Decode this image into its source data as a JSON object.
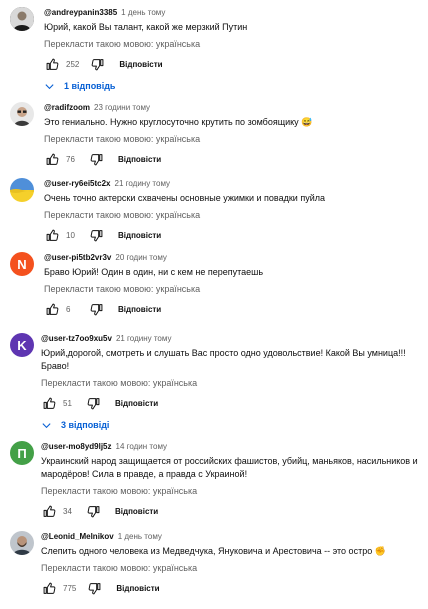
{
  "translate_label": "Перекласти такою мовою: українська",
  "reply_label": "Відповісти",
  "comments": [
    {
      "author": "@andreypanin3385",
      "time": "1 день тому",
      "text": "Юрий, какой Вы талант, какой же мерзкий Путин",
      "likes": "252",
      "replies": "1 відповідь",
      "avatar_icon": "man-in-dark-shirt-photo"
    },
    {
      "author": "@radifzoom",
      "time": "23 години тому",
      "text": "Это гениально. Нужно круглосуточно крутить по зомбоящику 😅",
      "likes": "76",
      "replies": "",
      "avatar_icon": "man-in-glasses-photo"
    },
    {
      "author": "@user-ry6ei5tc2x",
      "time": "21 годину тому",
      "text": "Очень точно актерски схвачены основные ужимки и повадки пуйла",
      "likes": "10",
      "replies": "",
      "avatar_icon": "ukrainian-flag-photo"
    },
    {
      "author": "@user-pi5tb2vr3v",
      "time": "20 годин тому",
      "text": "Браво Юрий! Один в один, ни с кем не перепутаешь",
      "likes": "6",
      "replies": "",
      "avatar_letter": "N",
      "avatar_color": "#f4511e"
    },
    {
      "author": "@user-tz7oo9xu5v",
      "time": "21 годину тому",
      "text": "Юрий,дорогой, смотреть и слушать Вас просто  одно  удовольствие! Какой Вы умница!!! Браво!",
      "likes": "51",
      "replies": "3 відповіді",
      "avatar_letter": "K",
      "avatar_color": "#5e35b1"
    },
    {
      "author": "@user-mo8yd9lj5z",
      "time": "14 годин тому",
      "text": "Украинский народ защищается от российских фашистов, убийц, маньяков, насильников и мародёров! Сила в правде, а правда с Украиной!",
      "likes": "34",
      "replies": "",
      "avatar_letter": "П",
      "avatar_color": "#43a047"
    },
    {
      "author": "@Leonid_Melnikov",
      "time": "1 день тому",
      "text": "Слепить одного человека из Медведчука, Януковича и Арестовича -- это остро ✊",
      "likes": "775",
      "replies": "",
      "avatar_icon": "man-with-beard-photo"
    }
  ]
}
